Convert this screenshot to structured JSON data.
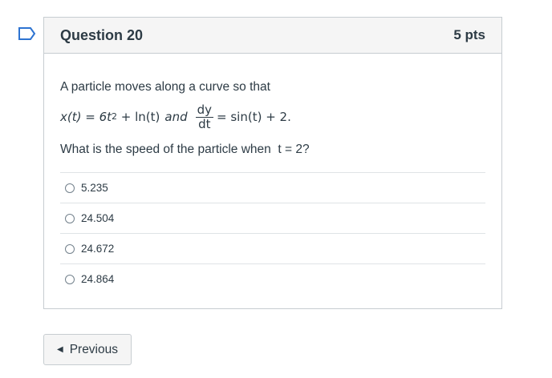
{
  "question": {
    "title": "Question 20",
    "points": "5 pts",
    "intro": "A particle moves along a curve so that",
    "math": {
      "x_lhs": "x(t) = 6t",
      "exp": "2",
      "x_rhs": " + ln(t)",
      "and": "and",
      "frac_num": "dy",
      "frac_den": "dt",
      "eq_rhs": "= sin(t) + 2."
    },
    "prompt": "What is the speed of the particle when  t = 2?",
    "answers": [
      "5.235",
      "24.504",
      "24.672",
      "24.864"
    ]
  },
  "nav": {
    "previous_label": "Previous",
    "previous_icon": "caret-left-icon"
  },
  "colors": {
    "flag": "#2d73d1",
    "border": "#c7cdd1",
    "header_bg": "#f5f5f5",
    "text": "#2d3b45"
  }
}
